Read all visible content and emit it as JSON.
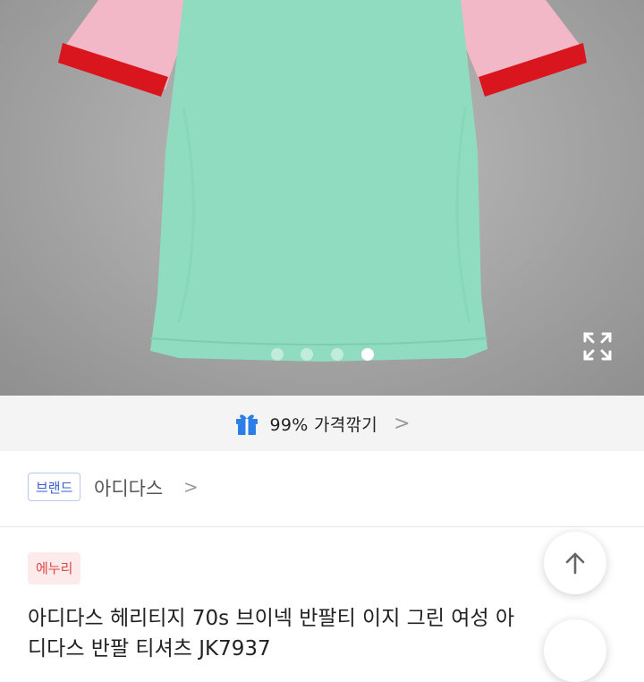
{
  "product_image": {
    "shirt_body_color": "#8fdcc0",
    "sleeve_color": "#f2b8c8",
    "cuff_color": "#d9161e",
    "slide_count": 4,
    "active_slide": 4,
    "expand_icon": "expand-icon"
  },
  "deal": {
    "icon": "gift-icon",
    "label": "99% 가격깎기",
    "chevron": ">"
  },
  "brand": {
    "tag": "브랜드",
    "name": "아디다스",
    "chevron": ">"
  },
  "listing": {
    "badge": "에누리",
    "badge_color": "#e04646",
    "title_line1": "아디다스 헤리티지 70s 브이넥 반팔티 이지 그린 여성 아",
    "title_line2": "디다스 반팔 티셔츠 JK7937"
  },
  "floating": {
    "scroll_top_icon": "arrow-up-icon"
  }
}
